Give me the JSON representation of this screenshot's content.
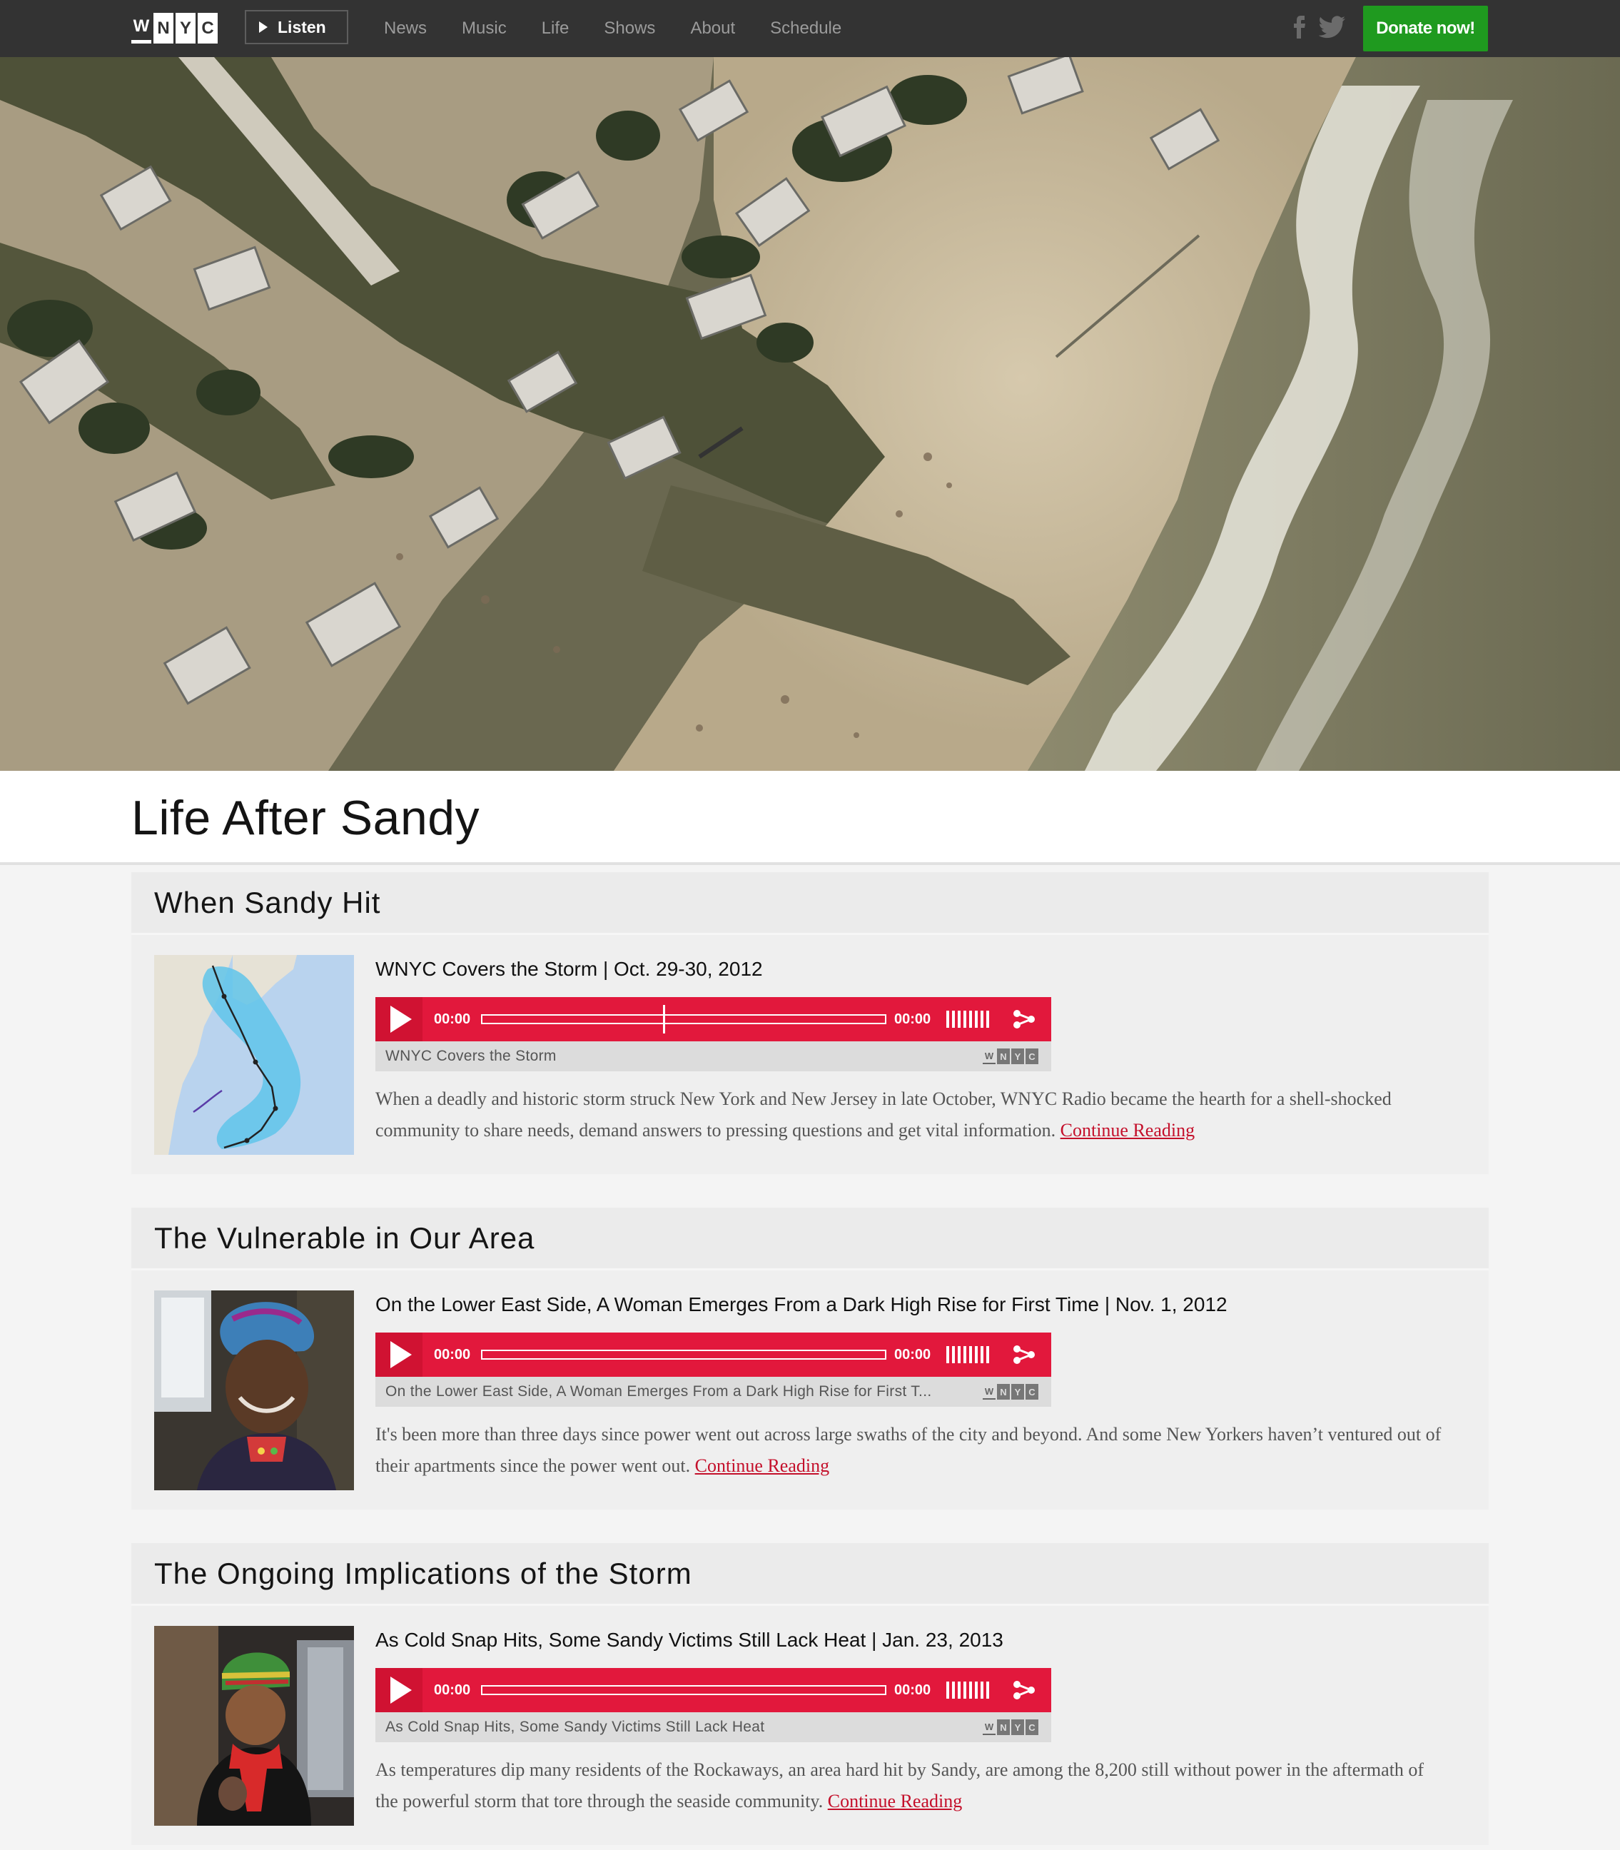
{
  "header": {
    "logo_letters": [
      "W",
      "N",
      "Y",
      "C"
    ],
    "listen_label": "Listen",
    "nav_items": [
      "News",
      "Music",
      "Life",
      "Shows",
      "About",
      "Schedule"
    ],
    "social_icons": [
      "facebook-icon",
      "twitter-icon"
    ],
    "donate_label": "Donate now!",
    "colors": {
      "bar": "#333333",
      "donate": "#1f9a1f"
    }
  },
  "hero": {
    "alt": "Aerial view of storm-damaged coastline after Hurricane Sandy"
  },
  "page_title": "Life After Sandy",
  "sections": [
    {
      "heading": "When Sandy Hit",
      "story": {
        "title": "WNYC Covers the Storm | Oct. 29-30, 2012",
        "player": {
          "elapsed": "00:00",
          "duration": "00:00",
          "audio_title": "WNYC Covers the Storm"
        },
        "text": "When a deadly and historic storm struck New York and New Jersey in late October, WNYC Radio became the hearth for a shell-shocked community to share needs, demand answers to pressing questions and get vital information.",
        "link": "Continue Reading"
      }
    },
    {
      "heading": "The Vulnerable in Our Area",
      "story": {
        "title": "On the Lower East Side, A Woman Emerges From a Dark High Rise for First Time | Nov. 1, 2012",
        "player": {
          "elapsed": "00:00",
          "duration": "00:00",
          "audio_title": "On the Lower East Side, A Woman Emerges From a Dark High Rise for First T..."
        },
        "text": "It's been more than three days since power went out across large swaths of the city and beyond. And some New Yorkers haven’t ventured out of their apartments since the power went out.",
        "link": "Continue Reading"
      }
    },
    {
      "heading": "The Ongoing Implications of the Storm",
      "story": {
        "title": "As Cold Snap Hits, Some Sandy Victims Still Lack Heat | Jan. 23, 2013",
        "player": {
          "elapsed": "00:00",
          "duration": "00:00",
          "audio_title": "As Cold Snap Hits, Some Sandy Victims Still Lack Heat"
        },
        "text": "As temperatures dip many residents of the Rockaways, an area hard hit by Sandy, are among the 8,200 still without power in the aftermath of the powerful storm that tore through the seaside community.",
        "link": "Continue Reading"
      }
    }
  ],
  "player_colors": {
    "bar": "#e2183c",
    "play_box": "#d01232",
    "subbar": "#dcdcdc"
  },
  "link_color": "#c4102b"
}
